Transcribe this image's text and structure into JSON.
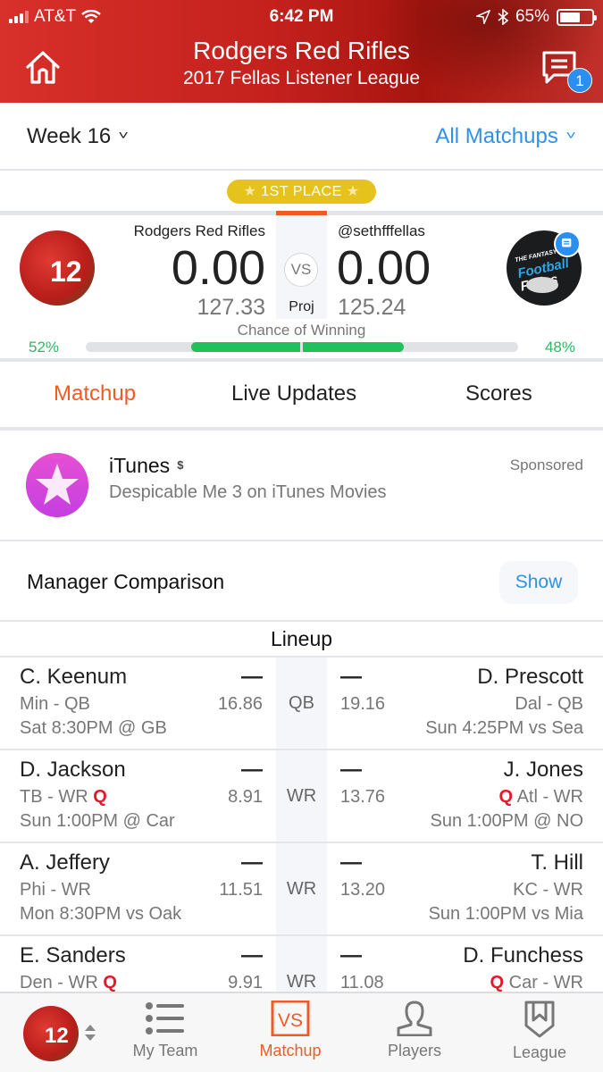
{
  "status_bar": {
    "carrier": "AT&T",
    "time": "6:42 PM",
    "battery_pct": "65%",
    "battery_level": 0.65
  },
  "header": {
    "title": "Rodgers Red Rifles",
    "subtitle": "2017 Fellas Listener League",
    "home_icon": "home-icon",
    "chat_icon": "chat-icon",
    "chat_badge": "1"
  },
  "week_bar": {
    "week_label": "Week 16",
    "matchups_label": "All Matchups"
  },
  "matchup": {
    "place_badge": "1ST PLACE",
    "star": "★",
    "vs_label": "VS",
    "proj_label": "Proj",
    "chance_label": "Chance of Winning",
    "left": {
      "team": "Rodgers Red Rifles",
      "score": "0.00",
      "projected": "127.33",
      "win_pct": "52%",
      "win_value": 52,
      "jersey_number": "12"
    },
    "right": {
      "team": "@sethfffellas",
      "score": "0.00",
      "projected": "125.24",
      "win_pct": "48%",
      "win_value": 48,
      "logo_line1": "THE FANTASY",
      "logo_line2": "Football",
      "logo_line3": "Fellas"
    }
  },
  "tabs": [
    {
      "label": "Matchup",
      "active": true
    },
    {
      "label": "Live Updates",
      "active": false
    },
    {
      "label": "Scores",
      "active": false
    }
  ],
  "ad": {
    "title": "iTunes",
    "subtitle": "Despicable Me 3 on iTunes Movies",
    "sponsored": "Sponsored",
    "dollar": "$"
  },
  "manager_comparison": {
    "label": "Manager Comparison",
    "button": "Show"
  },
  "lineup": {
    "title": "Lineup",
    "rows": [
      {
        "pos": "QB",
        "left": {
          "name": "C. Keenum",
          "team_pos": "Min - QB",
          "q": "",
          "game": "Sat 8:30PM @ GB",
          "score": "—",
          "proj": "16.86"
        },
        "right": {
          "name": "D. Prescott",
          "team_pos": "Dal - QB",
          "q": "",
          "game": "Sun 4:25PM vs Sea",
          "score": "—",
          "proj": "19.16"
        }
      },
      {
        "pos": "WR",
        "left": {
          "name": "D. Jackson",
          "team_pos": "TB - WR",
          "q": "Q",
          "game": "Sun 1:00PM @ Car",
          "score": "—",
          "proj": "8.91"
        },
        "right": {
          "name": "J. Jones",
          "team_pos": "Atl - WR",
          "q": "Q",
          "game": "Sun 1:00PM @ NO",
          "score": "—",
          "proj": "13.76"
        }
      },
      {
        "pos": "WR",
        "left": {
          "name": "A. Jeffery",
          "team_pos": "Phi - WR",
          "q": "",
          "game": "Mon 8:30PM vs Oak",
          "score": "—",
          "proj": "11.51"
        },
        "right": {
          "name": "T. Hill",
          "team_pos": "KC - WR",
          "q": "",
          "game": "Sun 1:00PM vs Mia",
          "score": "—",
          "proj": "13.20"
        }
      },
      {
        "pos": "WR",
        "left": {
          "name": "E. Sanders",
          "team_pos": "Den - WR",
          "q": "Q",
          "game": "",
          "score": "—",
          "proj": "9.91"
        },
        "right": {
          "name": "D. Funchess",
          "team_pos": "Car - WR",
          "q": "Q",
          "game": "",
          "score": "—",
          "proj": "11.08"
        }
      }
    ]
  },
  "tab_bar": {
    "items": [
      {
        "label": "My Team",
        "icon": "list-icon",
        "active": false
      },
      {
        "label": "Matchup",
        "icon": "vs-icon",
        "active": true
      },
      {
        "label": "Players",
        "icon": "person-icon",
        "active": false
      },
      {
        "label": "League",
        "icon": "shield-icon",
        "active": false
      }
    ],
    "vs_text": "VS"
  },
  "colors": {
    "header_red": "#c4211d",
    "accent_orange": "#f15a24",
    "link_blue": "#2e91ea",
    "win_green": "#20c05a",
    "badge_gold": "#e6c21c",
    "injury_red": "#e4192c"
  }
}
